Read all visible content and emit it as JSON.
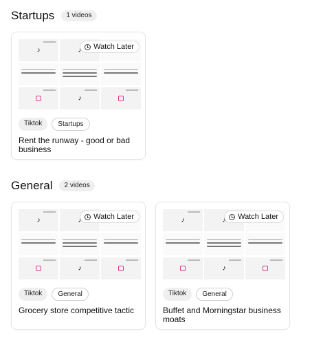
{
  "sections": [
    {
      "title": "Startups",
      "count": "1 videos",
      "cards": [
        {
          "watch_label": "Watch Later",
          "tags": [
            "Tiktok",
            "Startups"
          ],
          "title": "Rent the runway - good or bad business"
        }
      ]
    },
    {
      "title": "General",
      "count": "2 videos",
      "cards": [
        {
          "watch_label": "Watch Later",
          "tags": [
            "Tiktok",
            "General"
          ],
          "title": "Grocery store competitive tactic"
        },
        {
          "watch_label": "Watch Later",
          "tags": [
            "Tiktok",
            "General"
          ],
          "title": "Buffet and Morningstar business moats"
        }
      ]
    }
  ],
  "icons": {
    "watch": "clock-icon",
    "tile_logo": "tiktok-logo-icon",
    "tile_alt": "pink-square-icon"
  },
  "colors": {
    "accent_pink": "#e0358d",
    "badge_bg": "#efefef"
  }
}
